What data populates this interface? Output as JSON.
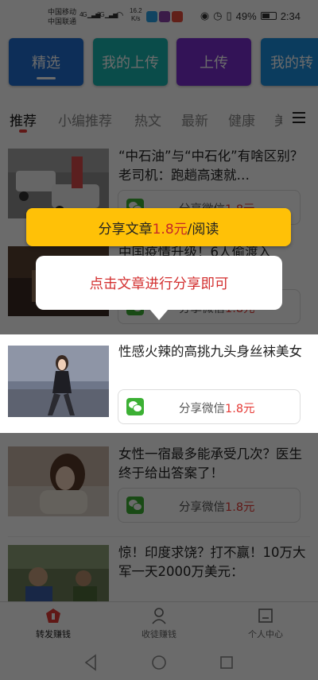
{
  "status_bar": {
    "carrier_1": "中国移动",
    "carrier_2": "中国联通",
    "net_1": "4G",
    "net_2": "3G",
    "speed_value": "16.2",
    "speed_unit": "K/s",
    "battery": "49%",
    "time": "2:34"
  },
  "top_cards": [
    {
      "label": "精选",
      "color": "#1f6fd1"
    },
    {
      "label": "我的上传",
      "color": "#1ab5b0"
    },
    {
      "label": "上传",
      "color": "#7b2fd0"
    },
    {
      "label": "我的转",
      "color": "#1b8fe0"
    }
  ],
  "tabs": [
    "推荐",
    "小编推荐",
    "热文",
    "最新",
    "健康",
    "美"
  ],
  "articles": [
    {
      "title": "“中石油”与“中石化”有啥区别？老司机：跑趟高速就…",
      "share_label": "分享微信",
      "price": "1.8元"
    },
    {
      "title": "中国疫情升级！6人偷渡入",
      "share_label": "分享微信",
      "price": "1.8元"
    },
    {
      "title": "性感火辣的高挑九头身丝袜美女",
      "share_label": "分享微信",
      "price": "1.8元"
    },
    {
      "title": "女性一宿最多能承受几次？医生终于给出答案了！",
      "share_label": "分享微信",
      "price": "1.8元"
    },
    {
      "title": "惊！印度求饶？打不赢！10万大军一天2000万美元：",
      "share_label": "分享微信",
      "price": "1.8元"
    }
  ],
  "tip_banner": {
    "prefix": "分享文章",
    "price": "1.8元",
    "suffix": "/阅读"
  },
  "tip_bubble": "点击文章进行分享即可",
  "bottom_nav": [
    {
      "label": "转发赚钱",
      "icon": "share-money-icon"
    },
    {
      "label": "收徒赚钱",
      "icon": "user-icon"
    },
    {
      "label": "个人中心",
      "icon": "home-icon"
    }
  ],
  "colors": {
    "accent_red": "#e53935",
    "wechat_green": "#3cb034",
    "tip_yellow": "#ffc107"
  }
}
